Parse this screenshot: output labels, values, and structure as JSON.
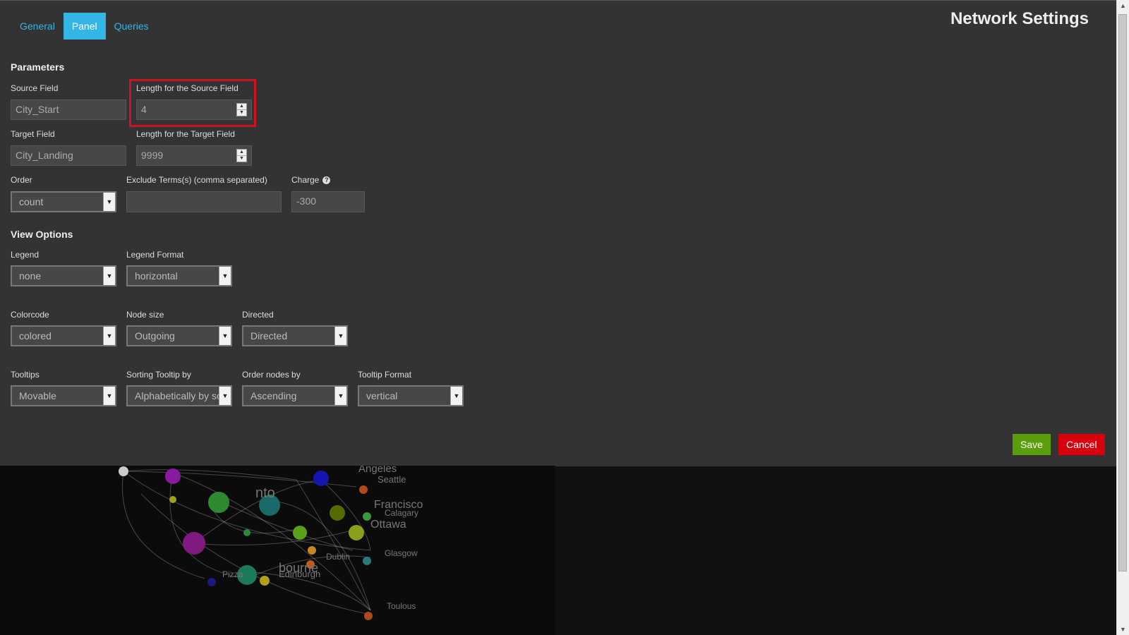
{
  "title": "Network Settings",
  "tabs": [
    "General",
    "Panel",
    "Queries"
  ],
  "active_tab": "Panel",
  "parameters": {
    "heading": "Parameters",
    "source_field": {
      "label": "Source Field",
      "value": "City_Start"
    },
    "source_length": {
      "label": "Length for the Source Field",
      "value": "4"
    },
    "target_field": {
      "label": "Target Field",
      "value": "City_Landing"
    },
    "target_length": {
      "label": "Length for the Target Field",
      "value": "9999"
    },
    "order": {
      "label": "Order",
      "value": "count"
    },
    "exclude": {
      "label": "Exclude Terms(s) (comma separated)",
      "value": ""
    },
    "charge": {
      "label": "Charge",
      "value": "-300"
    }
  },
  "view_options": {
    "heading": "View Options",
    "legend": {
      "label": "Legend",
      "value": "none"
    },
    "legend_format": {
      "label": "Legend Format",
      "value": "horizontal"
    },
    "colorcode": {
      "label": "Colorcode",
      "value": "colored"
    },
    "node_size": {
      "label": "Node size",
      "value": "Outgoing"
    },
    "directed": {
      "label": "Directed",
      "value": "Directed"
    },
    "tooltips": {
      "label": "Tooltips",
      "value": "Movable"
    },
    "sorting_tooltip": {
      "label": "Sorting Tooltip by",
      "value": "Alphabetically by source"
    },
    "order_nodes": {
      "label": "Order nodes by",
      "value": "Ascending"
    },
    "tooltip_format": {
      "label": "Tooltip Format",
      "value": "vertical"
    }
  },
  "buttons": {
    "save": "Save",
    "cancel": "Cancel"
  },
  "graph_labels": [
    "Angeles",
    "Seattle",
    "Francisco",
    "Calagary",
    "Ottawa",
    "Glasgow",
    "Dublin",
    "bourne",
    "Edinburgh",
    "Toulous",
    "nto",
    "Pizza"
  ],
  "colors": {
    "accent": "#33b5e5",
    "save": "#5b9e0c",
    "cancel": "#d9000d",
    "highlight": "#d0121e"
  }
}
